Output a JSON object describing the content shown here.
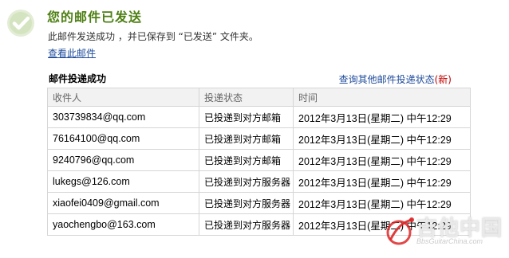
{
  "header": {
    "title": "您的邮件已发送",
    "success_message": "此邮件发送成功 ，并已保存到 “已发送” 文件夹。",
    "view_link": "查看此邮件"
  },
  "delivery": {
    "section_title": "邮件投递成功",
    "query_link": "查询其他邮件投递状态",
    "query_link_tag": "(新)",
    "columns": [
      "收件人",
      "投递状态",
      "时间"
    ],
    "rows": [
      {
        "recipient": "303739834@qq.com",
        "status": "已投递到对方邮箱",
        "time": "2012年3月13日(星期二) 中午12:29"
      },
      {
        "recipient": "76164100@qq.com",
        "status": "已投递到对方邮箱",
        "time": "2012年3月13日(星期二) 中午12:29"
      },
      {
        "recipient": "9240796@qq.com",
        "status": "已投递到对方邮箱",
        "time": "2012年3月13日(星期二) 中午12:29"
      },
      {
        "recipient": "lukegs@126.com",
        "status": "已投递到对方服务器",
        "time": "2012年3月13日(星期二) 中午12:29"
      },
      {
        "recipient": "xiaofei0409@gmail.com",
        "status": "已投递到对方服务器",
        "time": "2012年3月13日(星期二) 中午12:29"
      },
      {
        "recipient": "yaochengbo@163.com",
        "status": "已投递到对方服务器",
        "time": "2012年3月13日(星期二) 中午12:29"
      }
    ]
  },
  "watermark": {
    "text": "吉他中国",
    "url": "BbsGuitarChina.com"
  },
  "icons": {
    "success": "check-circle-icon"
  },
  "colors": {
    "title_green": "#4d7f12",
    "link_blue": "#1e4b9b",
    "new_tag_red": "#c00000",
    "header_bg": "#f2f2f2",
    "border": "#d5d5d5"
  }
}
